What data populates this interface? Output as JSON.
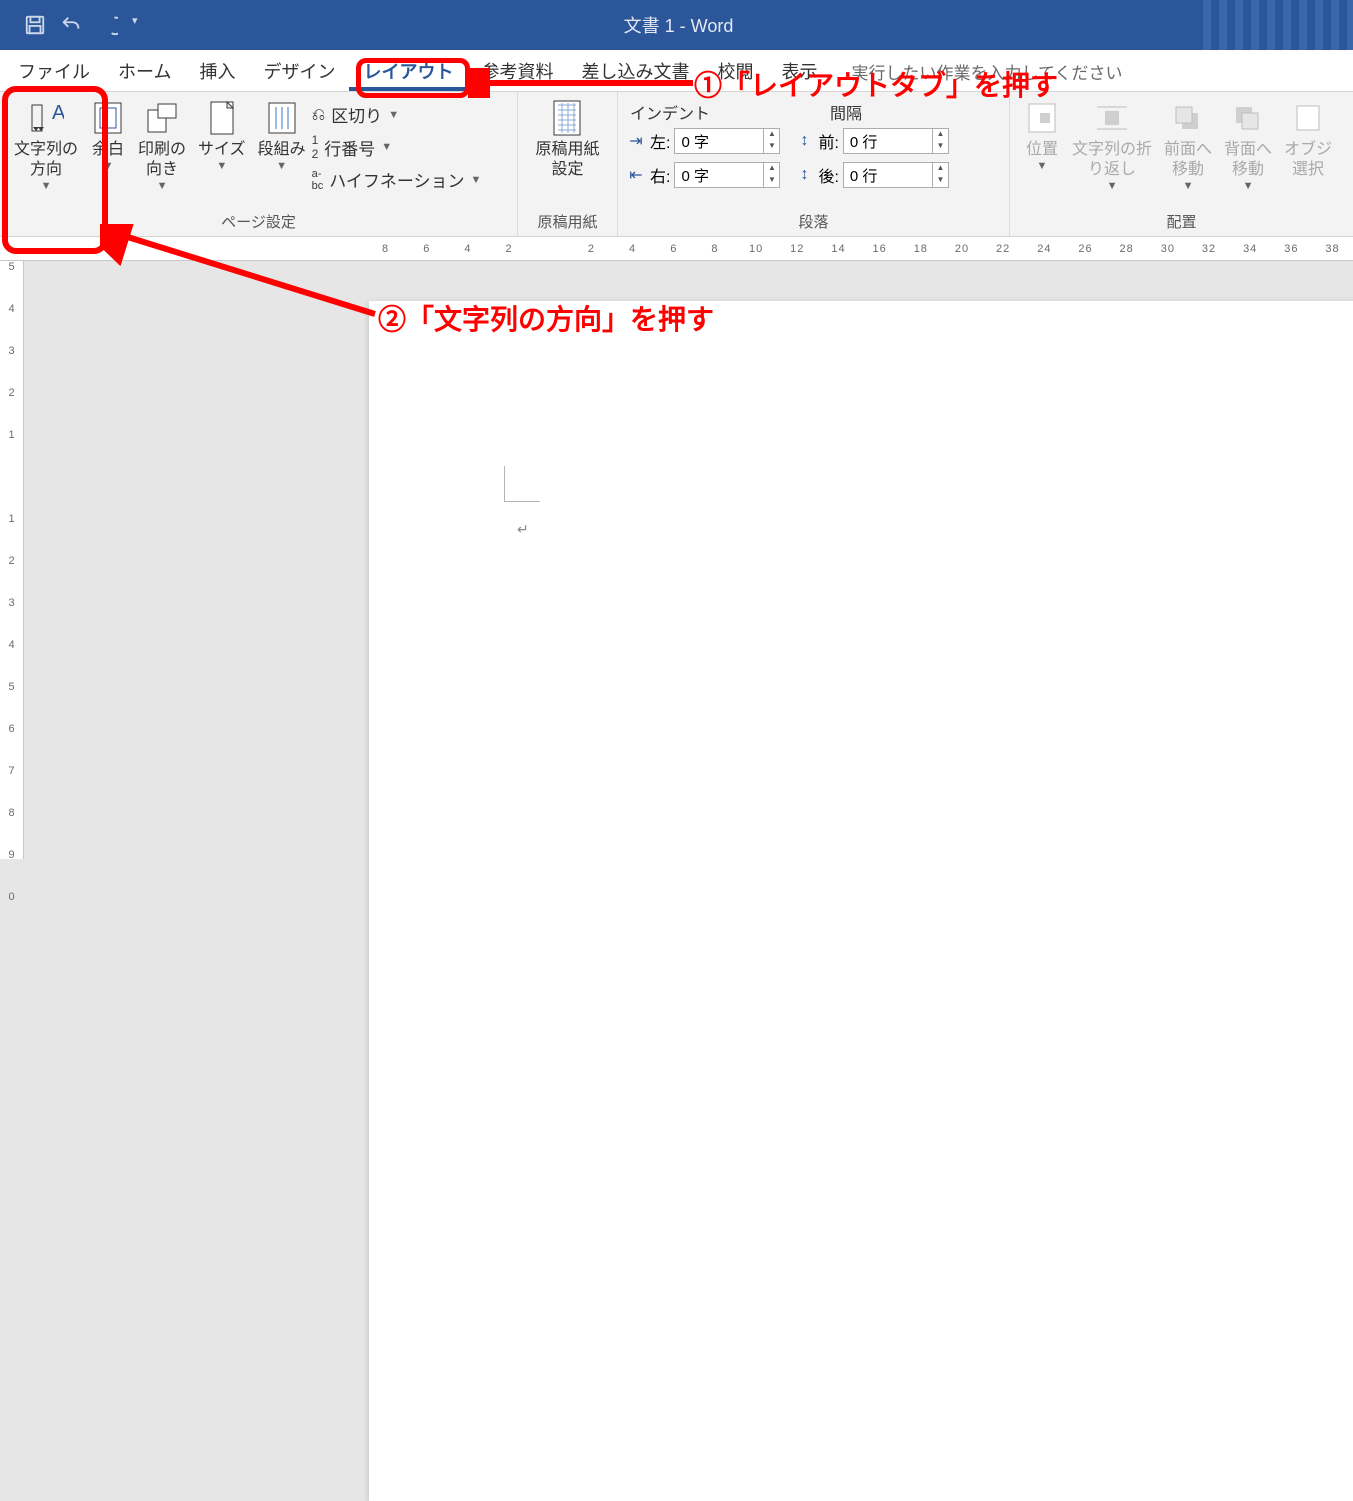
{
  "title": "文書 1  -  Word",
  "tabs": {
    "file": "ファイル",
    "home": "ホーム",
    "insert": "挿入",
    "design": "デザイン",
    "layout": "レイアウト",
    "references": "参考資料",
    "mailings": "差し込み文書",
    "review": "校閲",
    "view": "表示",
    "tellme": "実行したい作業を入力してください"
  },
  "page_setup_group": "ページ設定",
  "ms_paper_group": "原稿用紙",
  "paragraph_group": "段落",
  "arrange_group": "配置",
  "buttons": {
    "text_direction": "文字列の\n方向",
    "margins": "余白",
    "orientation": "印刷の\n向き",
    "size": "サイズ",
    "columns": "段組み",
    "breaks": "区切り",
    "line_numbers": "行番号",
    "hyphenation": "ハイフネーション",
    "ms_paper": "原稿用紙\n設定",
    "position": "位置",
    "wrap": "文字列の折\nり返し",
    "forward": "前面へ\n移動",
    "backward": "背面へ\n移動",
    "selection": "オブジ\n選択"
  },
  "paragraph": {
    "indent_label": "インデント",
    "spacing_label": "間隔",
    "left_label": "左:",
    "right_label": "右:",
    "before_label": "前:",
    "after_label": "後:",
    "left_value": "0 字",
    "right_value": "0 字",
    "before_value": "0 行",
    "after_value": "0 行"
  },
  "ruler_h": [
    "8",
    "6",
    "4",
    "2",
    "",
    "2",
    "4",
    "6",
    "8",
    "10",
    "12",
    "14",
    "16",
    "18",
    "20",
    "22",
    "24",
    "26",
    "28",
    "30",
    "32",
    "34",
    "36",
    "38"
  ],
  "ruler_v": [
    "5",
    "4",
    "3",
    "2",
    "1",
    "",
    "1",
    "2",
    "3",
    "4",
    "5",
    "6",
    "7",
    "8",
    "9",
    "0"
  ],
  "annotations": {
    "a1": "①「レイアウトタブ」を押す",
    "a2": "②「文字列の方向」を押す"
  }
}
